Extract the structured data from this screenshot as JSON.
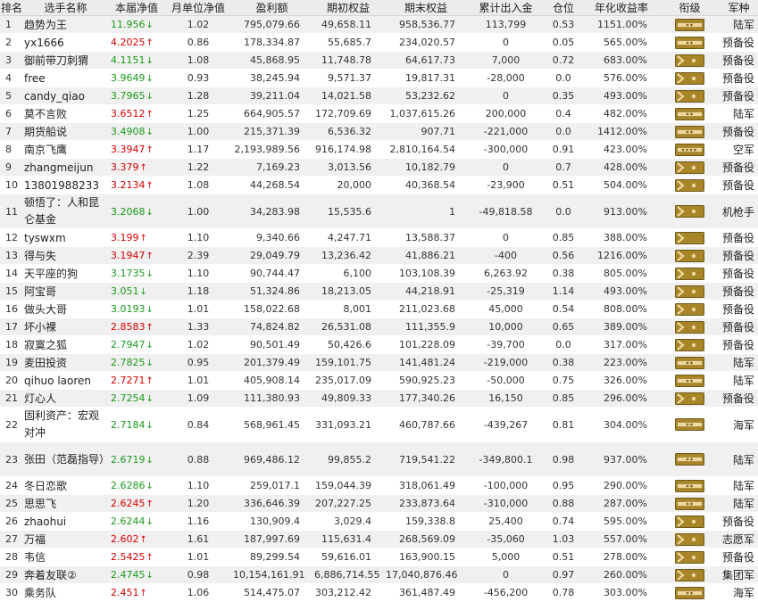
{
  "headers": [
    "排名",
    "选手名称",
    "本届净值",
    "月单位净值",
    "盈利额",
    "期初权益",
    "期末权益",
    "累计出入金",
    "仓位",
    "年化收益率",
    "衔级",
    "军种"
  ],
  "colors": {
    "up": "#d40000",
    "down": "#1a9a1a",
    "badge_gold": "#a88528",
    "badge_light": "#efd9a0"
  },
  "rows": [
    {
      "rank": "1",
      "name": "趋势为王",
      "nav": "11.956",
      "dir": "down",
      "monthly": "1.02",
      "profit": "795,079.66",
      "initial": "49,658.11",
      "final": "958,536.77",
      "flow": "113,799",
      "position": "0.53",
      "annual": "1151.00%",
      "badge": "2",
      "arm": "陆军"
    },
    {
      "rank": "2",
      "name": "yx1666",
      "nav": "4.2025",
      "dir": "up",
      "monthly": "0.86",
      "profit": "178,334.87",
      "initial": "55,685.7",
      "final": "234,020.57",
      "flow": "0",
      "position": "0.05",
      "annual": "565.00%",
      "badge": "2",
      "arm": "预备役"
    },
    {
      "rank": "3",
      "name": "御前带刀刺猬",
      "nav": "4.1151",
      "dir": "down",
      "monthly": "1.08",
      "profit": "45,868.95",
      "initial": "11,748.78",
      "final": "64,617.73",
      "flow": "7,000",
      "position": "0.72",
      "annual": "683.00%",
      "badge": "c1",
      "arm": "预备役"
    },
    {
      "rank": "4",
      "name": "free",
      "nav": "3.9649",
      "dir": "down",
      "monthly": "0.93",
      "profit": "38,245.94",
      "initial": "9,571.37",
      "final": "19,817.31",
      "flow": "-28,000",
      "position": "0.0",
      "annual": "576.00%",
      "badge": "c1",
      "arm": "预备役"
    },
    {
      "rank": "5",
      "name": "candy_qiao",
      "nav": "3.7965",
      "dir": "down",
      "monthly": "1.28",
      "profit": "39,211.04",
      "initial": "14,021.58",
      "final": "53,232.62",
      "flow": "0",
      "position": "0.35",
      "annual": "493.00%",
      "badge": "c1",
      "arm": "预备役"
    },
    {
      "rank": "6",
      "name": "莫不言败",
      "nav": "3.6512",
      "dir": "up",
      "monthly": "1.25",
      "profit": "664,905.57",
      "initial": "172,709.69",
      "final": "1,037,615.26",
      "flow": "200,000",
      "position": "0.4",
      "annual": "482.00%",
      "badge": "2",
      "arm": "陆军"
    },
    {
      "rank": "7",
      "name": "期货船说",
      "nav": "3.4908",
      "dir": "down",
      "monthly": "1.00",
      "profit": "215,371.39",
      "initial": "6,536.32",
      "final": "907.71",
      "flow": "-221,000",
      "position": "0.0",
      "annual": "1412.00%",
      "badge": "2",
      "arm": "预备役"
    },
    {
      "rank": "8",
      "name": "南京飞鹰",
      "nav": "3.3947",
      "dir": "up",
      "monthly": "1.17",
      "profit": "2,193,989.56",
      "initial": "916,174.98",
      "final": "2,810,164.54",
      "flow": "-300,000",
      "position": "0.91",
      "annual": "423.00%",
      "badge": "4",
      "arm": "空军"
    },
    {
      "rank": "9",
      "name": "zhangmeijun",
      "nav": "3.379",
      "dir": "up",
      "monthly": "1.22",
      "profit": "7,169.23",
      "initial": "3,013.56",
      "final": "10,182.79",
      "flow": "0",
      "position": "0.7",
      "annual": "428.00%",
      "badge": "c1",
      "arm": "预备役"
    },
    {
      "rank": "10",
      "name": "13801988233",
      "nav": "3.2134",
      "dir": "up",
      "monthly": "1.08",
      "profit": "44,268.54",
      "initial": "20,000",
      "final": "40,368.54",
      "flow": "-23,900",
      "position": "0.51",
      "annual": "504.00%",
      "badge": "c1",
      "arm": "预备役"
    },
    {
      "rank": "11",
      "name": "顿悟了：人和昆仑基金",
      "nav": "3.2068",
      "dir": "down",
      "monthly": "1.00",
      "profit": "34,283.98",
      "initial": "15,535.6",
      "final": "1",
      "flow": "-49,818.58",
      "position": "0.0",
      "annual": "913.00%",
      "badge": "c1",
      "arm": "机枪手"
    },
    {
      "rank": "12",
      "name": "tyswxm",
      "nav": "3.199",
      "dir": "up",
      "monthly": "1.10",
      "profit": "9,340.66",
      "initial": "4,247.71",
      "final": "13,588.37",
      "flow": "0",
      "position": "0.85",
      "annual": "388.00%",
      "badge": "c0",
      "arm": "预备役"
    },
    {
      "rank": "13",
      "name": "得与失",
      "nav": "3.1947",
      "dir": "up",
      "monthly": "2.39",
      "profit": "29,049.79",
      "initial": "13,236.42",
      "final": "41,886.21",
      "flow": "-400",
      "position": "0.56",
      "annual": "1216.00%",
      "badge": "c1",
      "arm": "预备役"
    },
    {
      "rank": "14",
      "name": "天平座的狗",
      "nav": "3.1735",
      "dir": "down",
      "monthly": "1.10",
      "profit": "90,744.47",
      "initial": "6,100",
      "final": "103,108.39",
      "flow": "6,263.92",
      "position": "0.38",
      "annual": "805.00%",
      "badge": "c1",
      "arm": "预备役"
    },
    {
      "rank": "15",
      "name": "阿宝哥",
      "nav": "3.051",
      "dir": "down",
      "monthly": "1.18",
      "profit": "51,324.86",
      "initial": "18,213.05",
      "final": "44,218.91",
      "flow": "-25,319",
      "position": "1.14",
      "annual": "493.00%",
      "badge": "c1",
      "arm": "预备役"
    },
    {
      "rank": "16",
      "name": "做头大哥",
      "nav": "3.0193",
      "dir": "down",
      "monthly": "1.01",
      "profit": "158,022.68",
      "initial": "8,001",
      "final": "211,023.68",
      "flow": "45,000",
      "position": "0.54",
      "annual": "808.00%",
      "badge": "c1",
      "arm": "预备役"
    },
    {
      "rank": "17",
      "name": "坏小裸",
      "nav": "2.8583",
      "dir": "up",
      "monthly": "1.33",
      "profit": "74,824.82",
      "initial": "26,531.08",
      "final": "111,355.9",
      "flow": "10,000",
      "position": "0.65",
      "annual": "389.00%",
      "badge": "c1",
      "arm": "预备役"
    },
    {
      "rank": "18",
      "name": "寂寞之狐",
      "nav": "2.7947",
      "dir": "down",
      "monthly": "1.02",
      "profit": "90,501.49",
      "initial": "50,426.6",
      "final": "101,228.09",
      "flow": "-39,700",
      "position": "0.0",
      "annual": "317.00%",
      "badge": "c1",
      "arm": "预备役"
    },
    {
      "rank": "19",
      "name": "麦田投资",
      "nav": "2.7825",
      "dir": "down",
      "monthly": "0.95",
      "profit": "201,379.49",
      "initial": "159,101.75",
      "final": "141,481.24",
      "flow": "-219,000",
      "position": "0.38",
      "annual": "223.00%",
      "badge": "2",
      "arm": "陆军"
    },
    {
      "rank": "20",
      "name": "qihuo laoren",
      "nav": "2.7271",
      "dir": "up",
      "monthly": "1.01",
      "profit": "405,908.14",
      "initial": "235,017.09",
      "final": "590,925.23",
      "flow": "-50,000",
      "position": "0.75",
      "annual": "326.00%",
      "badge": "2",
      "arm": "陆军"
    },
    {
      "rank": "21",
      "name": "灯心人",
      "nav": "2.7254",
      "dir": "down",
      "monthly": "1.09",
      "profit": "111,380.93",
      "initial": "49,809.33",
      "final": "177,340.26",
      "flow": "16,150",
      "position": "0.85",
      "annual": "296.00%",
      "badge": "c1",
      "arm": "预备役"
    },
    {
      "rank": "22",
      "name": "固利资产：宏观对冲",
      "nav": "2.7184",
      "dir": "down",
      "monthly": "0.84",
      "profit": "568,961.45",
      "initial": "331,093.21",
      "final": "460,787.66",
      "flow": "-439,267",
      "position": "0.81",
      "annual": "304.00%",
      "badge": "2",
      "arm": "海军"
    },
    {
      "rank": "23",
      "name": "张田（范磊指导）",
      "nav": "2.6719",
      "dir": "down",
      "monthly": "0.88",
      "profit": "969,486.12",
      "initial": "99,855.2",
      "final": "719,541.22",
      "flow": "-349,800.1",
      "position": "0.98",
      "annual": "937.00%",
      "badge": "2",
      "arm": "陆军"
    },
    {
      "rank": "24",
      "name": "冬日恋歌",
      "nav": "2.6286",
      "dir": "down",
      "monthly": "1.10",
      "profit": "259,017.1",
      "initial": "159,044.39",
      "final": "318,061.49",
      "flow": "-100,000",
      "position": "0.95",
      "annual": "290.00%",
      "badge": "2",
      "arm": "陆军"
    },
    {
      "rank": "25",
      "name": "思思飞",
      "nav": "2.6245",
      "dir": "up",
      "monthly": "1.20",
      "profit": "336,646.39",
      "initial": "207,227.25",
      "final": "233,873.64",
      "flow": "-310,000",
      "position": "0.88",
      "annual": "287.00%",
      "badge": "2",
      "arm": "陆军"
    },
    {
      "rank": "26",
      "name": "zhaohui",
      "nav": "2.6244",
      "dir": "down",
      "monthly": "1.16",
      "profit": "130,909.4",
      "initial": "3,029.4",
      "final": "159,338.8",
      "flow": "25,400",
      "position": "0.74",
      "annual": "595.00%",
      "badge": "c1",
      "arm": "预备役"
    },
    {
      "rank": "27",
      "name": "万福",
      "nav": "2.602",
      "dir": "up",
      "monthly": "1.61",
      "profit": "187,997.69",
      "initial": "115,631.4",
      "final": "268,569.09",
      "flow": "-35,060",
      "position": "1.03",
      "annual": "557.00%",
      "badge": "c1",
      "arm": "志愿军"
    },
    {
      "rank": "28",
      "name": "韦信",
      "nav": "2.5425",
      "dir": "up",
      "monthly": "1.01",
      "profit": "89,299.54",
      "initial": "59,616.01",
      "final": "163,900.15",
      "flow": "5,000",
      "position": "0.51",
      "annual": "278.00%",
      "badge": "c1",
      "arm": "预备役"
    },
    {
      "rank": "29",
      "name": "奔着友联②",
      "nav": "2.4745",
      "dir": "down",
      "monthly": "0.98",
      "profit": "10,154,161.91",
      "initial": "6,886,714.55",
      "final": "17,040,876.46",
      "flow": "0",
      "position": "0.97",
      "annual": "260.00%",
      "badge": "c1",
      "arm": "集团军"
    },
    {
      "rank": "30",
      "name": "乘务队",
      "nav": "2.451",
      "dir": "up",
      "monthly": "1.06",
      "profit": "514,475.07",
      "initial": "303,212.42",
      "final": "361,487.49",
      "flow": "-456,200",
      "position": "0.78",
      "annual": "303.00%",
      "badge": "2",
      "arm": "海军"
    }
  ]
}
